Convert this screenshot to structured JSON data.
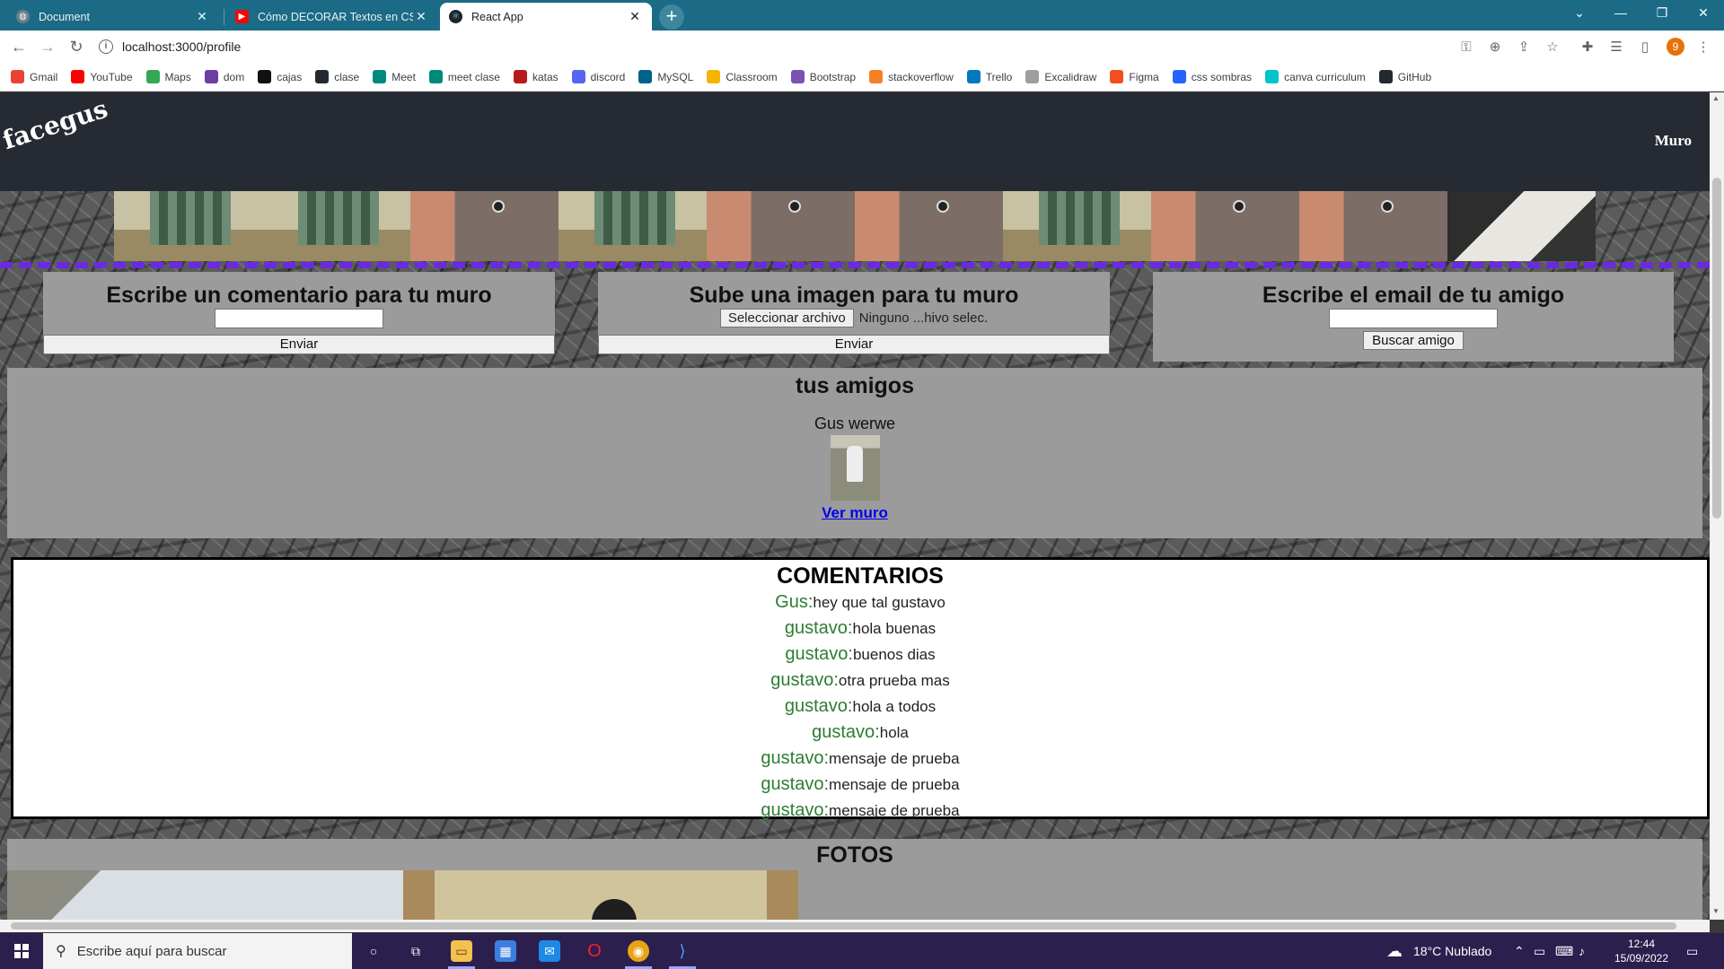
{
  "tabs": [
    {
      "title": "Document",
      "active": false
    },
    {
      "title": "Cómo DECORAR Textos en CSS",
      "active": false
    },
    {
      "title": "React App",
      "active": true
    }
  ],
  "window_controls": {
    "chevron": "⌄",
    "minimize": "—",
    "restore": "❐",
    "close": "✕"
  },
  "address": {
    "url": "localhost:3000/profile"
  },
  "bookmarks": [
    {
      "label": "Gmail",
      "icon": "gmail-icon",
      "color": "#ea4335"
    },
    {
      "label": "YouTube",
      "icon": "youtube-icon",
      "color": "#ff0000"
    },
    {
      "label": "Maps",
      "icon": "maps-icon",
      "color": "#34a853"
    },
    {
      "label": "dom",
      "icon": "dom-icon",
      "color": "#6b3fa0"
    },
    {
      "label": "cajas",
      "icon": "cajas-icon",
      "color": "#111111"
    },
    {
      "label": "clase",
      "icon": "github-icon",
      "color": "#24292f"
    },
    {
      "label": "Meet",
      "icon": "meet-icon",
      "color": "#00897b"
    },
    {
      "label": "meet clase",
      "icon": "meet-icon",
      "color": "#00897b"
    },
    {
      "label": "katas",
      "icon": "katas-icon",
      "color": "#b71c1c"
    },
    {
      "label": "discord",
      "icon": "discord-icon",
      "color": "#5865f2"
    },
    {
      "label": "MySQL",
      "icon": "mysql-icon",
      "color": "#00618a"
    },
    {
      "label": "Classroom",
      "icon": "classroom-icon",
      "color": "#f4b400"
    },
    {
      "label": "Bootstrap",
      "icon": "bootstrap-icon",
      "color": "#7952b3"
    },
    {
      "label": "stackoverflow",
      "icon": "stackoverflow-icon",
      "color": "#f48024"
    },
    {
      "label": "Trello",
      "icon": "trello-icon",
      "color": "#0079bf"
    },
    {
      "label": "Excalidraw",
      "icon": "excalidraw-icon",
      "color": "#9e9e9e"
    },
    {
      "label": "Figma",
      "icon": "figma-icon",
      "color": "#f24e1e"
    },
    {
      "label": "css sombras",
      "icon": "css-icon",
      "color": "#2962ff"
    },
    {
      "label": "canva curriculum",
      "icon": "canva-icon",
      "color": "#00c4cc"
    },
    {
      "label": "GitHub",
      "icon": "github-icon",
      "color": "#24292f"
    }
  ],
  "profile_initial": "9",
  "app": {
    "logo": "facegus",
    "nav": {
      "muro": "Muro"
    }
  },
  "forms": {
    "comment": {
      "title": "Escribe un comentario para tu muro",
      "button": "Enviar"
    },
    "image": {
      "title": "Sube una imagen para tu muro",
      "file_button": "Seleccionar archivo",
      "file_status": "Ninguno ...hivo selec.",
      "button": "Enviar"
    },
    "friend": {
      "title": "Escribe el email de tu amigo",
      "button": "Buscar amigo"
    }
  },
  "friends": {
    "title": "tus amigos",
    "items": [
      {
        "name": "Gus werwe",
        "link": "Ver muro"
      }
    ]
  },
  "comments": {
    "title": "COMENTARIOS",
    "items": [
      {
        "author": "Gus:",
        "text": "hey que tal gustavo"
      },
      {
        "author": "gustavo:",
        "text": "hola buenas"
      },
      {
        "author": "gustavo:",
        "text": "buenos dias"
      },
      {
        "author": "gustavo:",
        "text": "otra prueba mas"
      },
      {
        "author": "gustavo:",
        "text": "hola a todos"
      },
      {
        "author": "gustavo:",
        "text": "hola"
      },
      {
        "author": "gustavo:",
        "text": "mensaje de prueba"
      },
      {
        "author": "gustavo:",
        "text": "mensaje de prueba"
      },
      {
        "author": "gustavo:",
        "text": "mensaje de prueba"
      }
    ]
  },
  "photos": {
    "title": "FOTOS"
  },
  "taskbar": {
    "search_placeholder": "Escribe aquí para buscar",
    "weather": "18°C  Nublado",
    "time": "12:44",
    "date": "15/09/2022"
  },
  "colors": {
    "accent_dashed": "#6a2be0",
    "header_bg": "#262a33",
    "panel_bg": "#9b9b9b",
    "comment_author": "#2e7d32",
    "tab_bar": "#1b6b86",
    "taskbar": "#2b1f4e"
  }
}
